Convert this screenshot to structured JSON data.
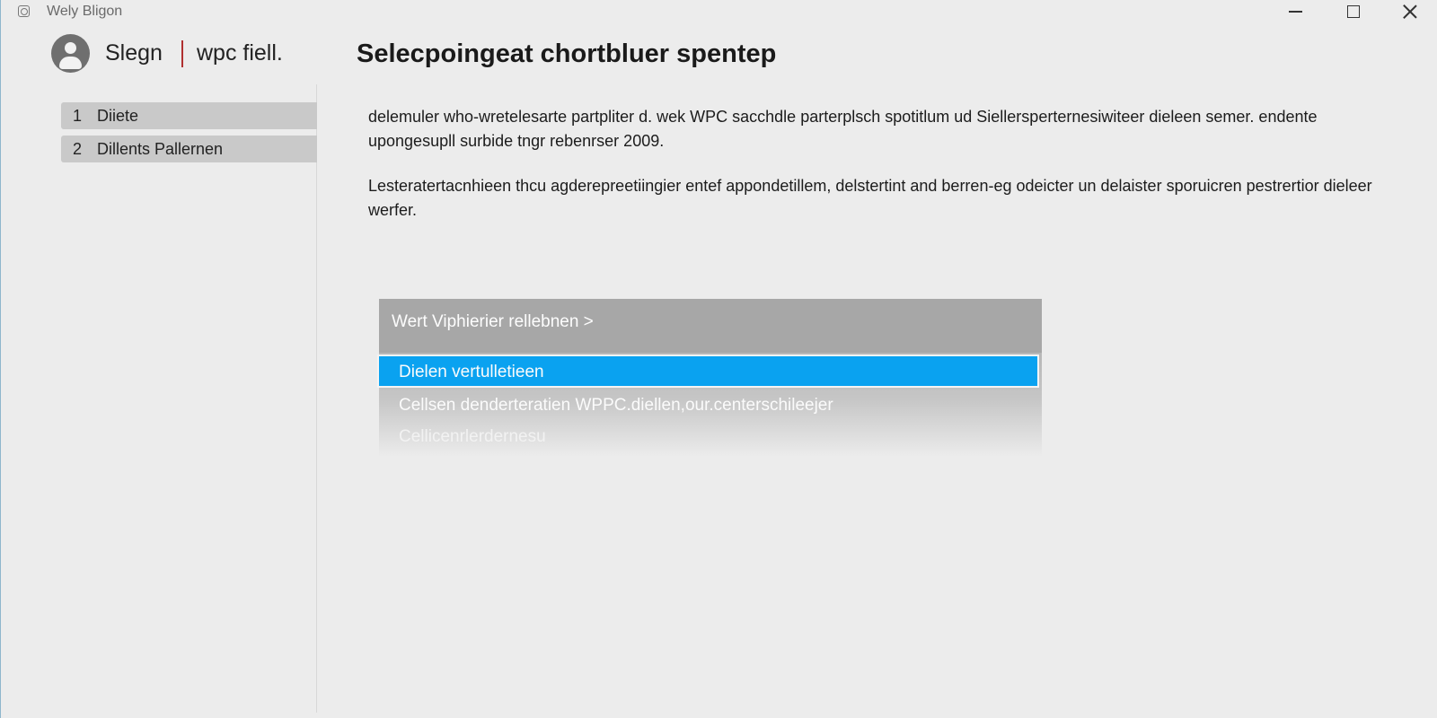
{
  "window": {
    "title": "Wely Bligon"
  },
  "header": {
    "brand_name": "Slegn",
    "brand_sub": "wpc fiell.",
    "page_title": "Selecpoingeat chortbluer spentep"
  },
  "sidebar": {
    "items": [
      {
        "num": "1",
        "label": "Diiete"
      },
      {
        "num": "2",
        "label": "Dillents Pallernen"
      }
    ]
  },
  "main": {
    "paragraph_1": "delemuler who-wretelesarte partpliter d. wek WPC sacchdle parterplsch spotitlum ud Siellersperternesiwiteer dieleen semer. endente upongesupll surbide tngr rebenrser 2009.",
    "paragraph_2": "Lesteratertacnhieen thcu agderepreetiingier entef appondetillem, delstertint and berren-eg odeicter un delaister sporuicren pestrertior dieleer werfer."
  },
  "dropdown": {
    "header": "Wert Viphierier rellebnen >",
    "options": [
      "Dielen vertulletieen",
      "Cellsen denderteratien WPPC.diellen,our.centerschileejer",
      "Cellicenrlerdernesu"
    ],
    "selected_index": 0,
    "selected_color": "#0aa2f0"
  },
  "icons": {
    "app": "app-icon",
    "avatar": "user-avatar-icon",
    "minimize": "minimize-icon",
    "maximize": "maximize-icon",
    "close": "close-icon"
  }
}
